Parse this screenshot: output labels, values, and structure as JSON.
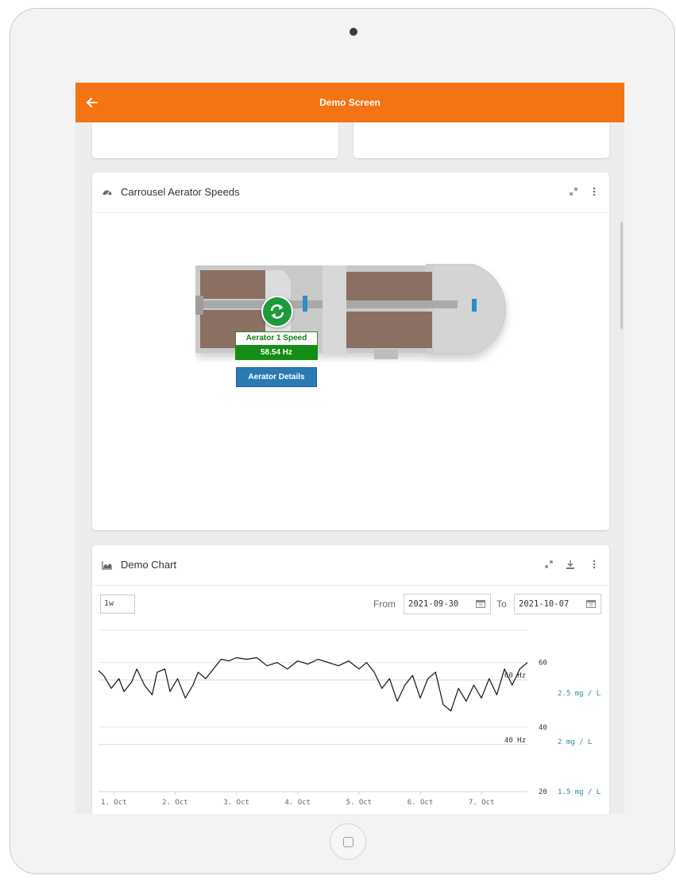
{
  "header": {
    "title": "Demo Screen",
    "back_icon": "arrow-left-icon"
  },
  "aerator_card": {
    "title": "Carrousel Aerator Speeds",
    "icon": "gauge-icon",
    "speed_label": "Aerator 1 Speed",
    "speed_value": "58.54 Hz",
    "details_button": "Aerator Details"
  },
  "chart_card": {
    "title": "Demo Chart",
    "icon": "area-chart-icon",
    "range_value": "1w",
    "from_label": "From",
    "from_date": "2021-09-30",
    "to_label": "To",
    "to_date": "2021-10-07"
  },
  "colors": {
    "accent": "#f47414",
    "status_green": "#148d14",
    "button_blue": "#2a7ab3",
    "secondary_axis": "#2a8c9c"
  },
  "chart_data": {
    "type": "line",
    "x_tick_labels": [
      "1. Oct",
      "2. Oct",
      "3. Oct",
      "4. Oct",
      "5. Oct",
      "6. Oct",
      "7. Oct"
    ],
    "xlim": [
      "2021-09-30T18:00",
      "2021-10-07T18:00"
    ],
    "y_axis_left_ticks": [
      20,
      40,
      60
    ],
    "y_axis_right_ticks": [
      "1.5 mg / L",
      "2 mg / L",
      "2.5 mg / L"
    ],
    "ylim": [
      20,
      70
    ],
    "plot_lines": [
      {
        "label": "60 Hz",
        "value": 60
      },
      {
        "label": "40 Hz",
        "value": 40
      }
    ],
    "grid": true,
    "series": [
      {
        "x": [
          "2021-09-30T18:00",
          "2021-09-30T20:00",
          "2021-09-30T23:00",
          "2021-10-01T02:00",
          "2021-10-01T04:00",
          "2021-10-01T07:00",
          "2021-10-01T09:00",
          "2021-10-01T12:00",
          "2021-10-01T15:00",
          "2021-10-01T17:00",
          "2021-10-01T20:00",
          "2021-10-01T22:00",
          "2021-10-02T01:00",
          "2021-10-02T04:00",
          "2021-10-02T07:00",
          "2021-10-02T09:00",
          "2021-10-02T12:00",
          "2021-10-02T15:00",
          "2021-10-02T18:00",
          "2021-10-02T21:00",
          "2021-10-03T00:00",
          "2021-10-03T04:00",
          "2021-10-03T08:00",
          "2021-10-03T12:00",
          "2021-10-03T16:00",
          "2021-10-03T20:00",
          "2021-10-04T00:00",
          "2021-10-04T04:00",
          "2021-10-04T08:00",
          "2021-10-04T12:00",
          "2021-10-04T16:00",
          "2021-10-04T20:00",
          "2021-10-05T00:00",
          "2021-10-05T03:00",
          "2021-10-05T06:00",
          "2021-10-05T09:00",
          "2021-10-05T12:00",
          "2021-10-05T15:00",
          "2021-10-05T18:00",
          "2021-10-05T21:00",
          "2021-10-06T00:00",
          "2021-10-06T03:00",
          "2021-10-06T06:00",
          "2021-10-06T09:00",
          "2021-10-06T12:00",
          "2021-10-06T15:00",
          "2021-10-06T18:00",
          "2021-10-06T21:00",
          "2021-10-07T00:00",
          "2021-10-07T03:00",
          "2021-10-07T06:00",
          "2021-10-07T09:00",
          "2021-10-07T12:00",
          "2021-10-07T15:00",
          "2021-10-07T18:00"
        ],
        "values": [
          57.5,
          56,
          52,
          55,
          51,
          54,
          58,
          53,
          50,
          57,
          58,
          51,
          55,
          49,
          53,
          57,
          55,
          58,
          61,
          60.5,
          61.5,
          61,
          61.5,
          59,
          60,
          58,
          60.5,
          59.5,
          61,
          60,
          59,
          60.5,
          58,
          60,
          57,
          52,
          55,
          48,
          53,
          56,
          49,
          55,
          57,
          47,
          45,
          52,
          48,
          53,
          49,
          55,
          50,
          58,
          53,
          58,
          60
        ]
      }
    ]
  }
}
